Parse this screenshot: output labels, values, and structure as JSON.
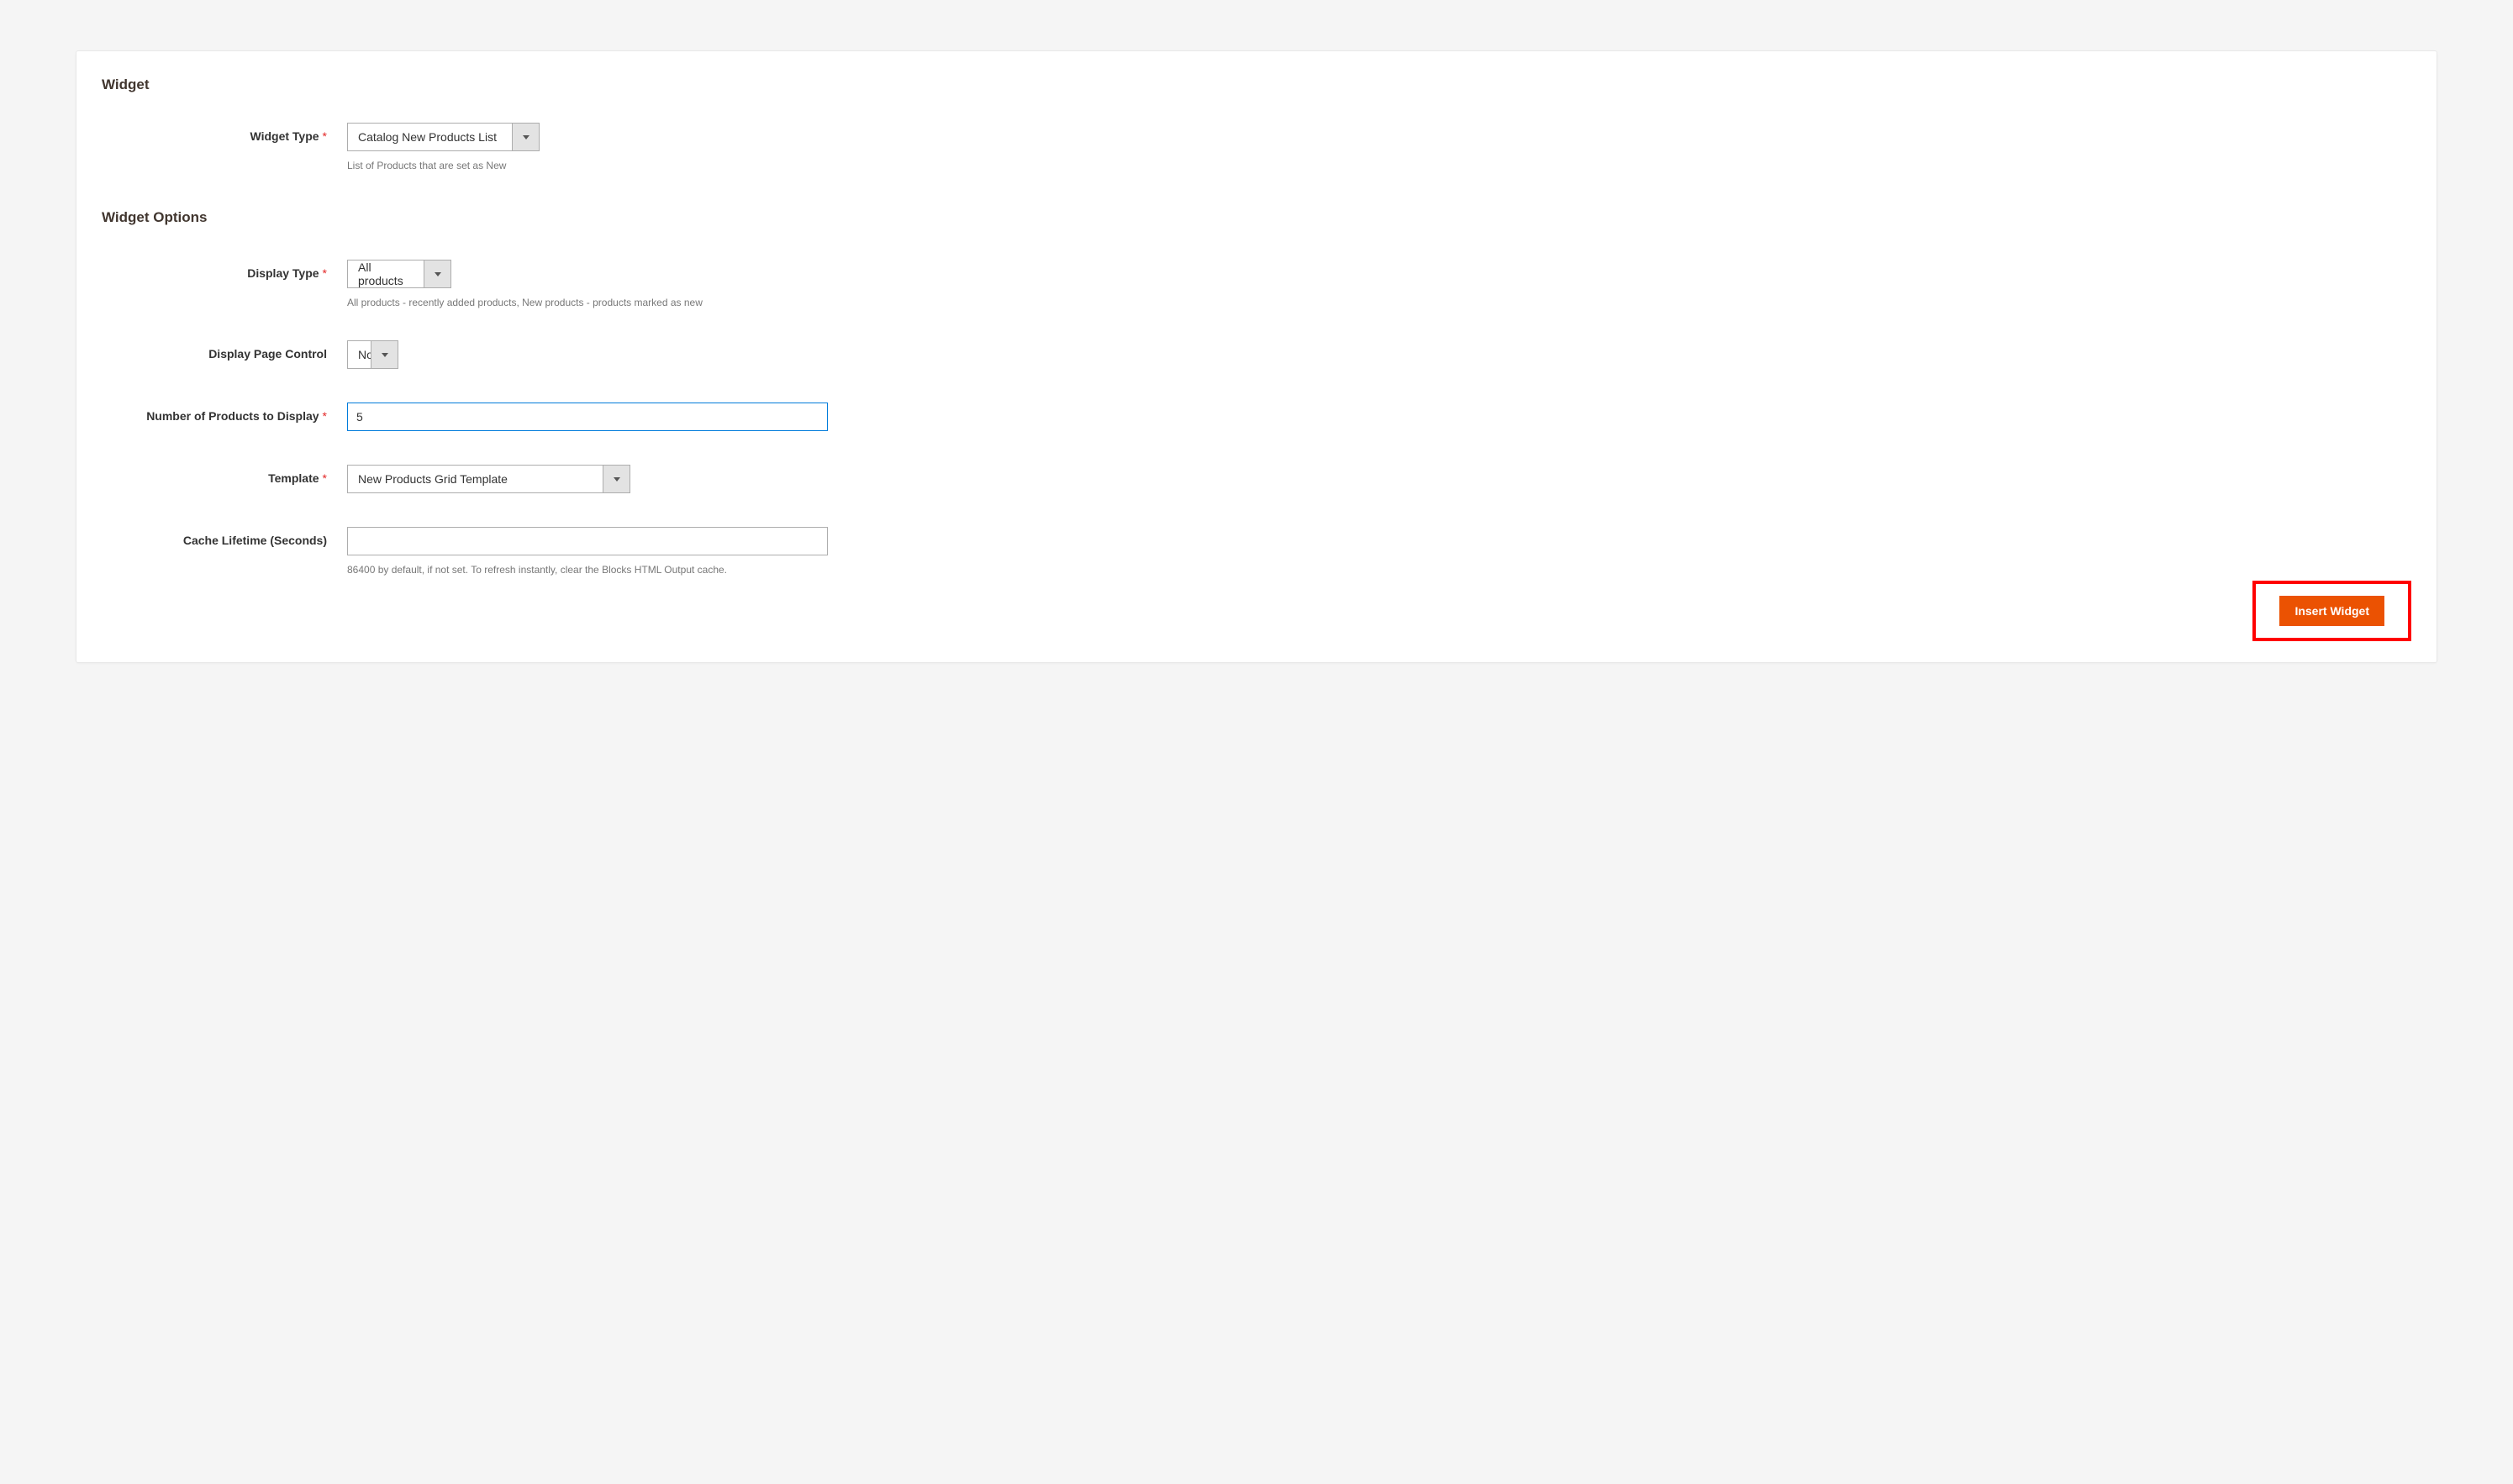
{
  "section_widget": "Widget",
  "section_options": "Widget Options",
  "fields": {
    "widget_type": {
      "label": "Widget Type",
      "value": "Catalog New Products List",
      "note": "List of Products that are set as New"
    },
    "display_type": {
      "label": "Display Type",
      "value": "All products",
      "note": "All products - recently added products, New products - products marked as new"
    },
    "page_control": {
      "label": "Display Page Control",
      "value": "No"
    },
    "num_products": {
      "label": "Number of Products to Display",
      "value": "5"
    },
    "template": {
      "label": "Template",
      "value": "New Products Grid Template"
    },
    "cache": {
      "label": "Cache Lifetime (Seconds)",
      "value": "",
      "note": "86400 by default, if not set. To refresh instantly, clear the Blocks HTML Output cache."
    }
  },
  "button": "Insert Widget"
}
